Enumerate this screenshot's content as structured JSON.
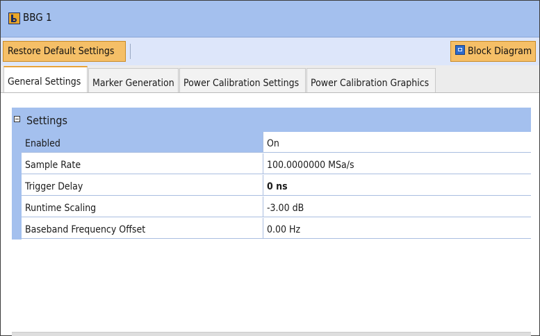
{
  "window": {
    "title": "BBG 1"
  },
  "toolbar": {
    "restore_label": "Restore Default Settings",
    "block_label": "Block Diagram"
  },
  "tabs": [
    {
      "label": "General Settings",
      "active": true
    },
    {
      "label": "Marker Generation",
      "active": false
    },
    {
      "label": "Power Calibration Settings",
      "active": false
    },
    {
      "label": "Power Calibration Graphics",
      "active": false
    }
  ],
  "section": {
    "title": "Settings",
    "icon": "collapse-icon"
  },
  "rows": [
    {
      "label": "Enabled",
      "value": "On"
    },
    {
      "label": "Sample Rate",
      "value": "100.0000000 MSa/s"
    },
    {
      "label": "Trigger Delay",
      "value": "0 ns"
    },
    {
      "label": "Runtime Scaling",
      "value": "-3.00 dB"
    },
    {
      "label": "Baseband Frequency Offset",
      "value": "0.00 Hz"
    }
  ],
  "colors": {
    "header_blue": "#a4c0ee",
    "button_orange": "#f5bf67",
    "toolbar_bg": "#dde6fa"
  }
}
